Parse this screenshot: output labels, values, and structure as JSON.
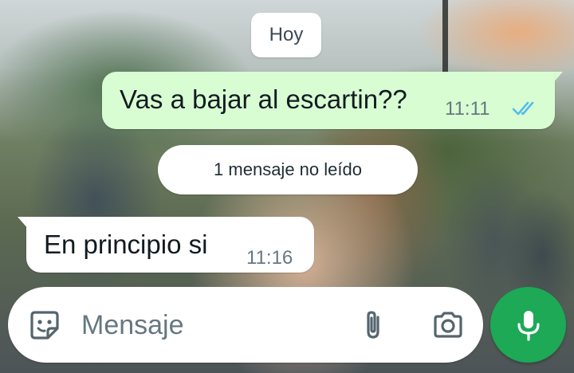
{
  "chat": {
    "date_chip": "Hoy",
    "unread_label": "1 mensaje no leído",
    "messages": [
      {
        "direction": "outgoing",
        "text": "Vas a bajar al escartin??",
        "time": "11:11",
        "status": "read"
      },
      {
        "direction": "incoming",
        "text": "En principio si",
        "time": "11:16"
      }
    ]
  },
  "composer": {
    "placeholder": "Mensaje",
    "value": "",
    "icons": {
      "sticker": "sticker-icon",
      "attach": "paperclip-icon",
      "camera": "camera-icon",
      "mic": "microphone-icon"
    }
  },
  "colors": {
    "outgoing_bubble": "#d9fdd3",
    "incoming_bubble": "#ffffff",
    "read_ticks": "#53bdeb",
    "mic_button": "#1da955",
    "icon_gray": "#54656f"
  }
}
